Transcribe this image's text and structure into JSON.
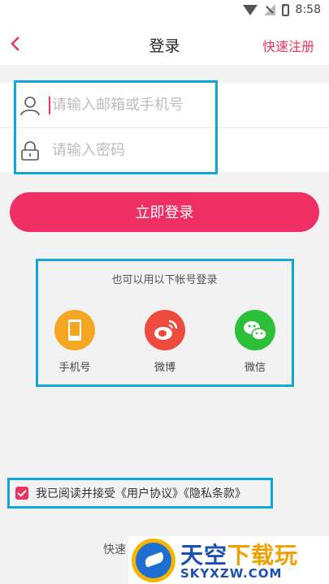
{
  "status_bar": {
    "time": "8:58"
  },
  "header": {
    "back_icon": "chevron-left-icon",
    "title": "登录",
    "register_label": "快速注册"
  },
  "form": {
    "account_placeholder": "请输入邮箱或手机号",
    "account_value": "",
    "password_placeholder": "请输入密码",
    "password_value": ""
  },
  "login_button": "立即登录",
  "alt_login": {
    "title": "也可以用以下帐号登录",
    "options": [
      {
        "label": "手机号",
        "icon": "phone-icon",
        "color": "#f5a623"
      },
      {
        "label": "微博",
        "icon": "weibo-icon",
        "color": "#ee4b3e"
      },
      {
        "label": "微信",
        "icon": "wechat-icon",
        "color": "#2bbf3a"
      }
    ]
  },
  "agreement": {
    "checked": true,
    "text": "我已阅读并接受",
    "user_agreement": "《用户协议》",
    "privacy": "《隐私条款》"
  },
  "bottom_text": "快速",
  "watermark": {
    "line1": "天空",
    "line1_accent": "下载玩",
    "line2": "SKYXZW.COM"
  },
  "colors": {
    "accent": "#e8365d",
    "button": "#ef2f63",
    "highlight": "#12a6d8"
  }
}
